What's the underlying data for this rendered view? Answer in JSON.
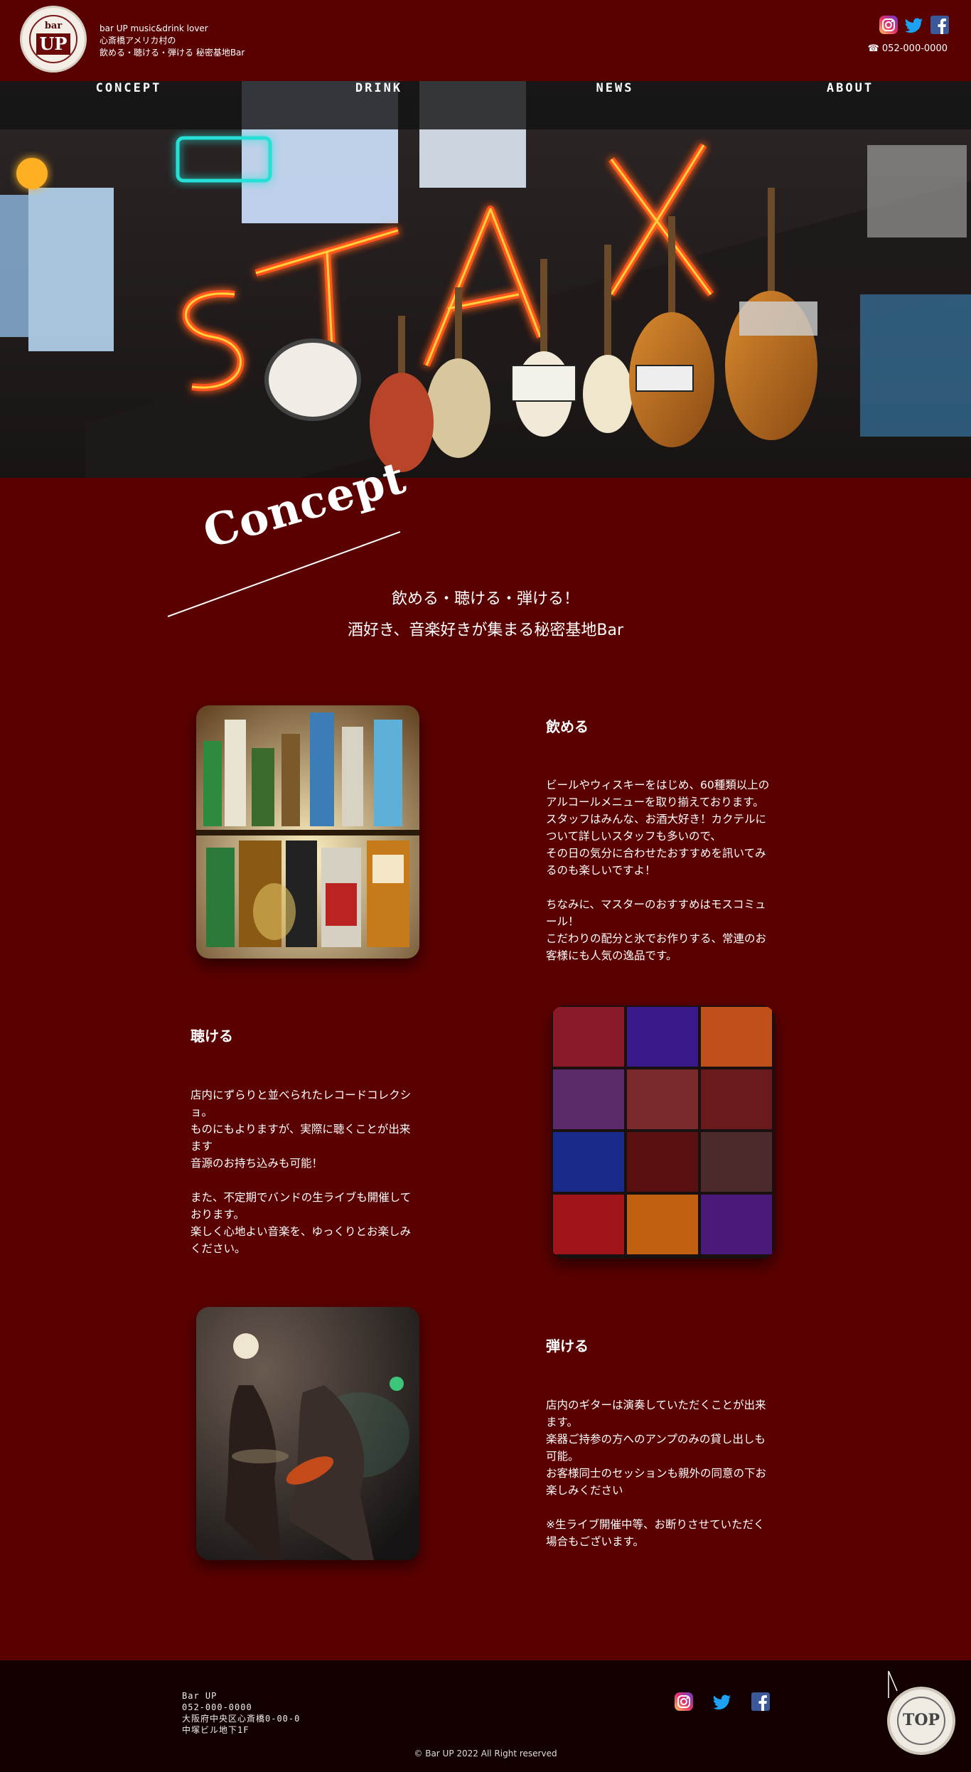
{
  "header": {
    "logo_small": "bar",
    "logo_big": "UP",
    "tagline": [
      "bar UP music&drink lover",
      "心斎橋アメリカ村の",
      "飲める・聴ける・弾ける 秘密基地Bar"
    ],
    "phone": "☎ 052-000-0000"
  },
  "social": [
    "instagram-icon",
    "twitter-icon",
    "facebook-icon"
  ],
  "nav": [
    "CONCEPT",
    "DRINK",
    "NEWS",
    "ABOUT"
  ],
  "concept": {
    "title": "Concept",
    "lead1": "飲める・聴ける・弾ける！",
    "lead2": "酒好き、音楽好きが集まる秘密基地Bar"
  },
  "sections": [
    {
      "title": "飲める",
      "text": "ビールやウィスキーをはじめ、60種類以上の\nアルコールメニューを取り揃えております。\nスタッフはみんな、お酒大好き！カクテルに\nついて詳しいスタッフも多いので、\nその日の気分に合わせたおすすめを訊いてみ\nるのも楽しいですよ！\n\nちなみに、マスターのおすすめはモスコミュ\nール！\nこだわりの配分と氷でお作りする、常連のお\n客様にも人気の逸品です。"
    },
    {
      "title": "聴ける",
      "text": "店内にずらりと並べられたレコードコレクシ\nョ。\nものにもよりますが、実際に聴くことが出来\nます\n音源のお持ち込みも可能！\n\nまた、不定期でバンドの生ライブも開催して\nおります。\n楽しく心地よい音楽を、ゆっくりとお楽しみ\nください。"
    },
    {
      "title": "弾ける",
      "text": "店内のギターは演奏していただくことが出来\nます。\n楽器ご持参の方へのアンプのみの貸し出しも\n可能。\nお客様同士のセッションも親外の同意の下お\n楽しみください\n\n※生ライブ開催中等、お断りさせていただく\n場合もございます。"
    }
  ],
  "footer": {
    "lines": [
      "Bar UP",
      "052-000-0000",
      "大阪府中央区心斎橋0-00-0",
      "中塚ビル地下1F"
    ],
    "copyright": "© Bar UP 2022 All Right reserved",
    "top_label": "TOP"
  }
}
